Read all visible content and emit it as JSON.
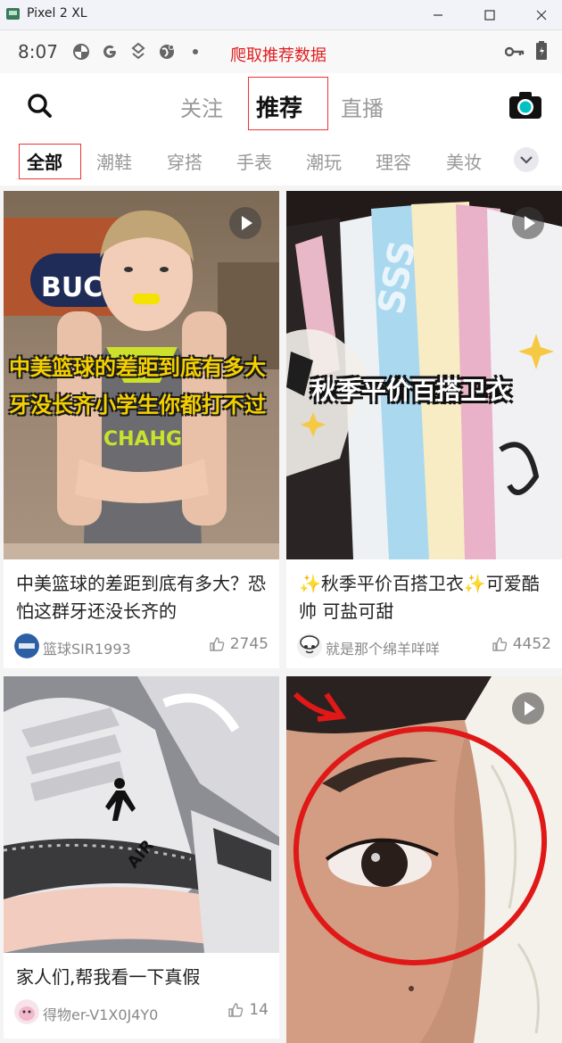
{
  "window": {
    "title": "Pixel 2 XL",
    "min_icon": "minimize-icon",
    "max_icon": "maximize-icon",
    "close_icon": "close-icon"
  },
  "status_bar": {
    "time": "8:07",
    "notice": "爬取推荐数据",
    "icons": [
      "pinwheel-icon",
      "google-icon",
      "location-icon",
      "globe-icon",
      "key-icon",
      "battery-icon"
    ]
  },
  "top_nav": {
    "tabs": [
      "关注",
      "推荐",
      "直播"
    ],
    "active_tab": "推荐",
    "search_icon": "search-icon",
    "camera_icon": "camera-icon"
  },
  "categories": {
    "items": [
      "全部",
      "潮鞋",
      "穿搭",
      "手表",
      "潮玩",
      "理容",
      "美妆"
    ],
    "active": "全部",
    "more_icon": "chevron-down-icon"
  },
  "feed": [
    {
      "overlay_lines": [
        "中美篮球的差距到底有多大",
        "牙没长齐小学生你都打不过"
      ],
      "title": "中美篮球的差距到底有多大？恐怕这群牙还没长齐的",
      "author": "篮球SIR1993",
      "likes": "2745",
      "is_video": true,
      "jersey_text": "CHAHGNG",
      "backdrop_text": "BUC"
    },
    {
      "overlay_lines": [
        "秋季平价百搭卫衣"
      ],
      "title": "✨秋季平价百搭卫衣✨可爱酷帅 可盐可甜",
      "author": "就是那个绵羊咩咩",
      "likes": "4452",
      "is_video": true
    },
    {
      "title": "家人们,帮我看一下真假",
      "author": "得物er-V1X0J4Y0",
      "likes": "14",
      "is_video": false,
      "shoe_text": "AIR"
    },
    {
      "is_video": true
    }
  ],
  "colors": {
    "accent_red": "#e02020",
    "highlight_yellow": "#f5d000",
    "active_text": "#111111",
    "inactive_text": "#999999"
  }
}
